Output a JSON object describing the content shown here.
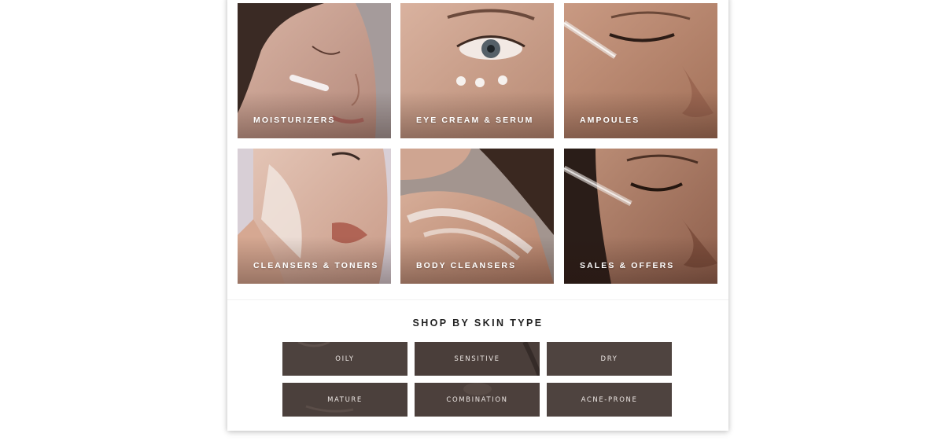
{
  "categories": [
    {
      "label": "MOISTURIZERS"
    },
    {
      "label": "EYE CREAM & SERUM"
    },
    {
      "label": "AMPOULES"
    },
    {
      "label": "CLEANSERS & TONERS"
    },
    {
      "label": "BODY CLEANSERS"
    },
    {
      "label": "SALES & OFFERS"
    }
  ],
  "skin_type": {
    "heading": "SHOP BY SKIN TYPE",
    "options": [
      {
        "label": "OILY"
      },
      {
        "label": "SENSITIVE"
      },
      {
        "label": "DRY"
      },
      {
        "label": "MATURE"
      },
      {
        "label": "COMBINATION"
      },
      {
        "label": "ACNE-PRONE"
      }
    ]
  },
  "colors": {
    "tile_label": "#ffffff",
    "skin_button_bg": "#4a3f3b",
    "skin_button_text": "#ece6e3",
    "heading_text": "#222222"
  }
}
